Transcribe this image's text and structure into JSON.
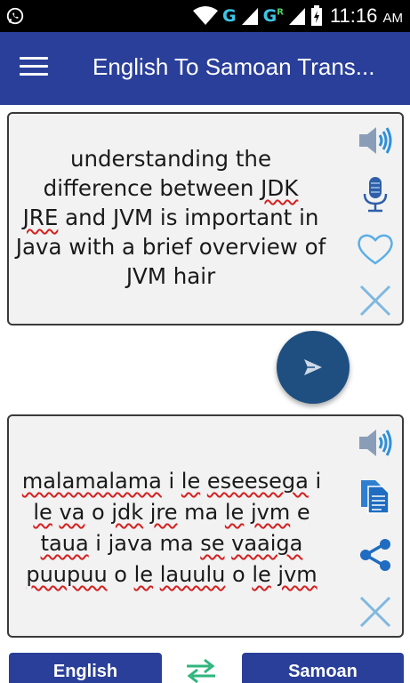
{
  "status_bar": {
    "network_1": "G",
    "network_2": "G",
    "network_2_badge": "R",
    "time": "11:16",
    "ampm": "AM",
    "icons": [
      "whatsapp-icon",
      "wifi-icon",
      "signal-icon",
      "battery-charging-icon"
    ]
  },
  "app_bar": {
    "title": "English To Samoan Trans...",
    "menu_icon": "hamburger-menu-icon",
    "color": "#2a3f9a"
  },
  "input_panel": {
    "line1": "understanding the",
    "line2_pre": "difference between ",
    "line2_err": "JDK",
    "line3_err": "JRE",
    "line3_post": " and JVM is important in",
    "line4": "Java with a brief overview of",
    "line5": "JVM hair",
    "icons": [
      "speaker-icon",
      "microphone-icon",
      "heart-icon",
      "close-icon"
    ]
  },
  "translate_button": {
    "icon": "send-icon",
    "color": "#1e4f80"
  },
  "output_panel": {
    "lines": [
      [
        {
          "t": "malamalama",
          "e": true
        },
        {
          "t": " i ",
          "e": false
        },
        {
          "t": "le",
          "e": true
        },
        {
          "t": " ",
          "e": false
        },
        {
          "t": "eseesega",
          "e": true
        },
        {
          "t": " i",
          "e": false
        }
      ],
      [
        {
          "t": "le",
          "e": true
        },
        {
          "t": " ",
          "e": false
        },
        {
          "t": "va",
          "e": true
        },
        {
          "t": " o ",
          "e": false
        },
        {
          "t": "jdk",
          "e": true
        },
        {
          "t": " ",
          "e": false
        },
        {
          "t": "jre",
          "e": true
        },
        {
          "t": " ma ",
          "e": false
        },
        {
          "t": "le",
          "e": true
        },
        {
          "t": " ",
          "e": false
        },
        {
          "t": "jvm",
          "e": true
        },
        {
          "t": " e",
          "e": false
        }
      ],
      [
        {
          "t": "taua",
          "e": true
        },
        {
          "t": " i java ma ",
          "e": false
        },
        {
          "t": "se",
          "e": true
        },
        {
          "t": " ",
          "e": false
        },
        {
          "t": "vaaiga",
          "e": true
        }
      ],
      [
        {
          "t": "puupuu",
          "e": true
        },
        {
          "t": " o ",
          "e": false
        },
        {
          "t": "le",
          "e": true
        },
        {
          "t": " ",
          "e": false
        },
        {
          "t": "lauulu",
          "e": true
        },
        {
          "t": " o ",
          "e": false
        },
        {
          "t": "le",
          "e": true
        },
        {
          "t": " ",
          "e": false
        },
        {
          "t": "jvm",
          "e": true
        }
      ]
    ],
    "icons": [
      "speaker-icon",
      "copy-icon",
      "share-icon",
      "close-icon"
    ]
  },
  "bottom_bar": {
    "source_language": "English",
    "target_language": "Samoan",
    "swap_icon": "swap-arrows-icon",
    "accent": "#2a3f9a",
    "swap_color": "#2eb67d"
  }
}
